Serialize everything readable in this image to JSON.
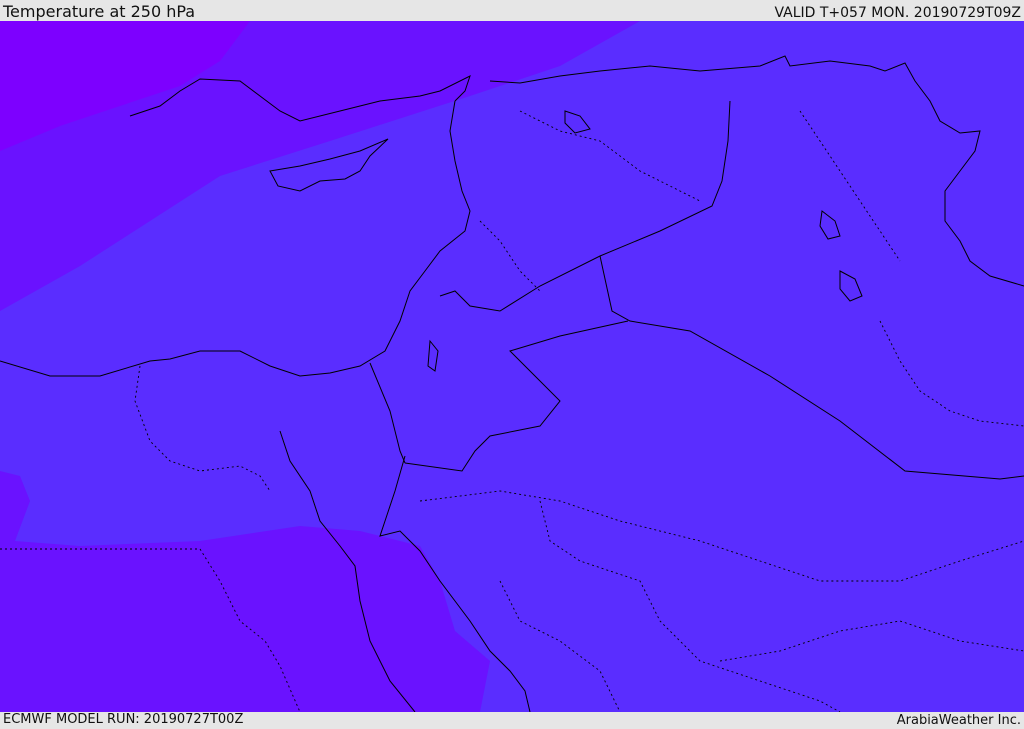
{
  "header": {
    "title": "Temperature at 250 hPa",
    "valid": "VALID T+057 MON. 20190729T09Z"
  },
  "footer": {
    "model_run": "ECMWF MODEL RUN: 20190727T00Z",
    "brand": "ArabiaWeather Inc."
  },
  "map": {
    "colors": {
      "temp_warmest": "#5a2dff",
      "temp_mid": "#6a12ff",
      "temp_coolest": "#7d00ff",
      "boundaries": "#000000"
    }
  }
}
